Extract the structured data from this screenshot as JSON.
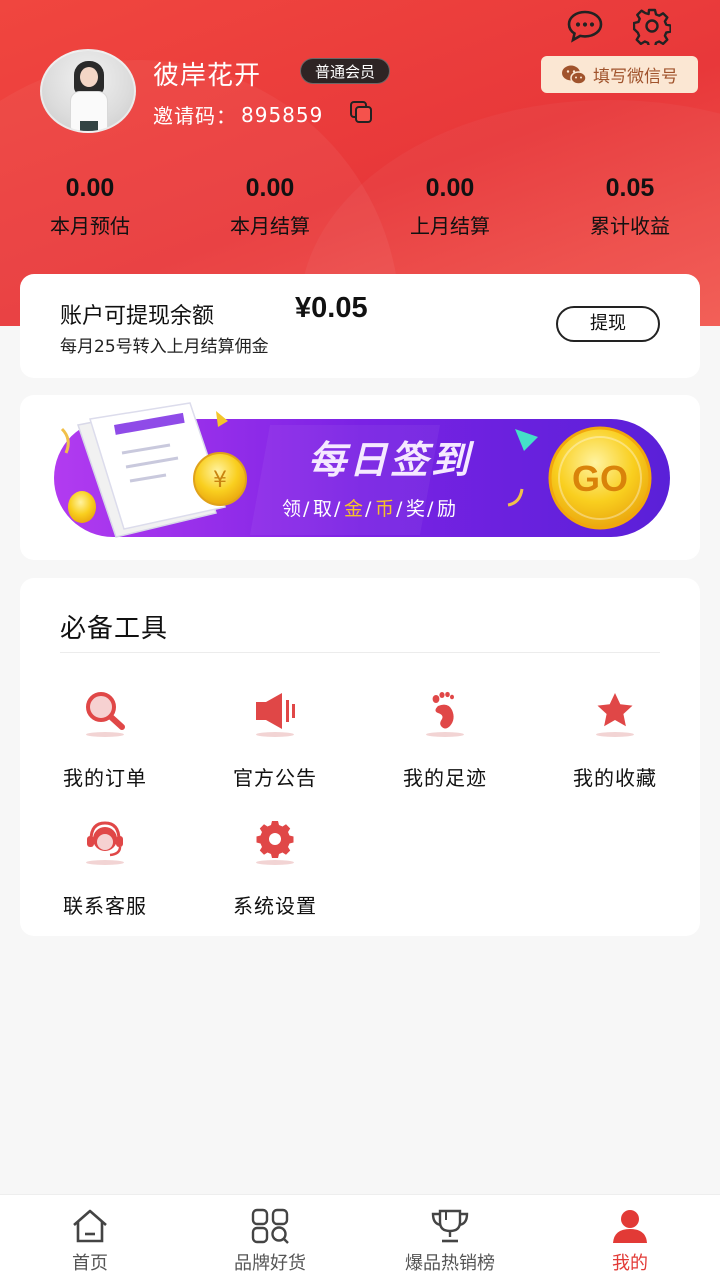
{
  "user": {
    "name": "彼岸花开",
    "badge": "普通会员",
    "invite_label": "邀请码：",
    "invite_code": "895859"
  },
  "header": {
    "wechat_button": "填写微信号",
    "icons": [
      "chat-bubble-icon",
      "settings-gear-icon",
      "copy-icon",
      "wechat-icon"
    ]
  },
  "stats": [
    {
      "value": "0.00",
      "label": "本月预估"
    },
    {
      "value": "0.00",
      "label": "本月结算"
    },
    {
      "value": "0.00",
      "label": "上月结算"
    },
    {
      "value": "0.05",
      "label": "累计收益"
    }
  ],
  "balance": {
    "title": "账户可提现余额",
    "amount": "¥0.05",
    "note": "每月25号转入上月结算佣金",
    "withdraw": "提现"
  },
  "banner": {
    "title": "每日签到",
    "chars": [
      "领",
      "/",
      "取",
      "/",
      "金",
      "/",
      "币",
      "/",
      "奖",
      "/",
      "励"
    ],
    "go": "GO"
  },
  "tools": {
    "title": "必备工具",
    "items": [
      {
        "label": "我的订单",
        "icon": "magnifier-icon"
      },
      {
        "label": "官方公告",
        "icon": "speaker-icon"
      },
      {
        "label": "我的足迹",
        "icon": "footprint-icon"
      },
      {
        "label": "我的收藏",
        "icon": "star-icon"
      },
      {
        "label": "联系客服",
        "icon": "headset-icon"
      },
      {
        "label": "系统设置",
        "icon": "gear-icon"
      }
    ]
  },
  "nav": [
    {
      "label": "首页",
      "icon": "home-icon",
      "active": false
    },
    {
      "label": "品牌好货",
      "icon": "grid-apps-icon",
      "active": false
    },
    {
      "label": "爆品热销榜",
      "icon": "trophy-icon",
      "active": false
    },
    {
      "label": "我的",
      "icon": "user-icon",
      "active": true
    }
  ],
  "colors": {
    "brand_red": "#e8383a",
    "accent_purple": "#7b2ee6",
    "gold": "#f7c51b",
    "badge_bg": "#2e2424"
  }
}
